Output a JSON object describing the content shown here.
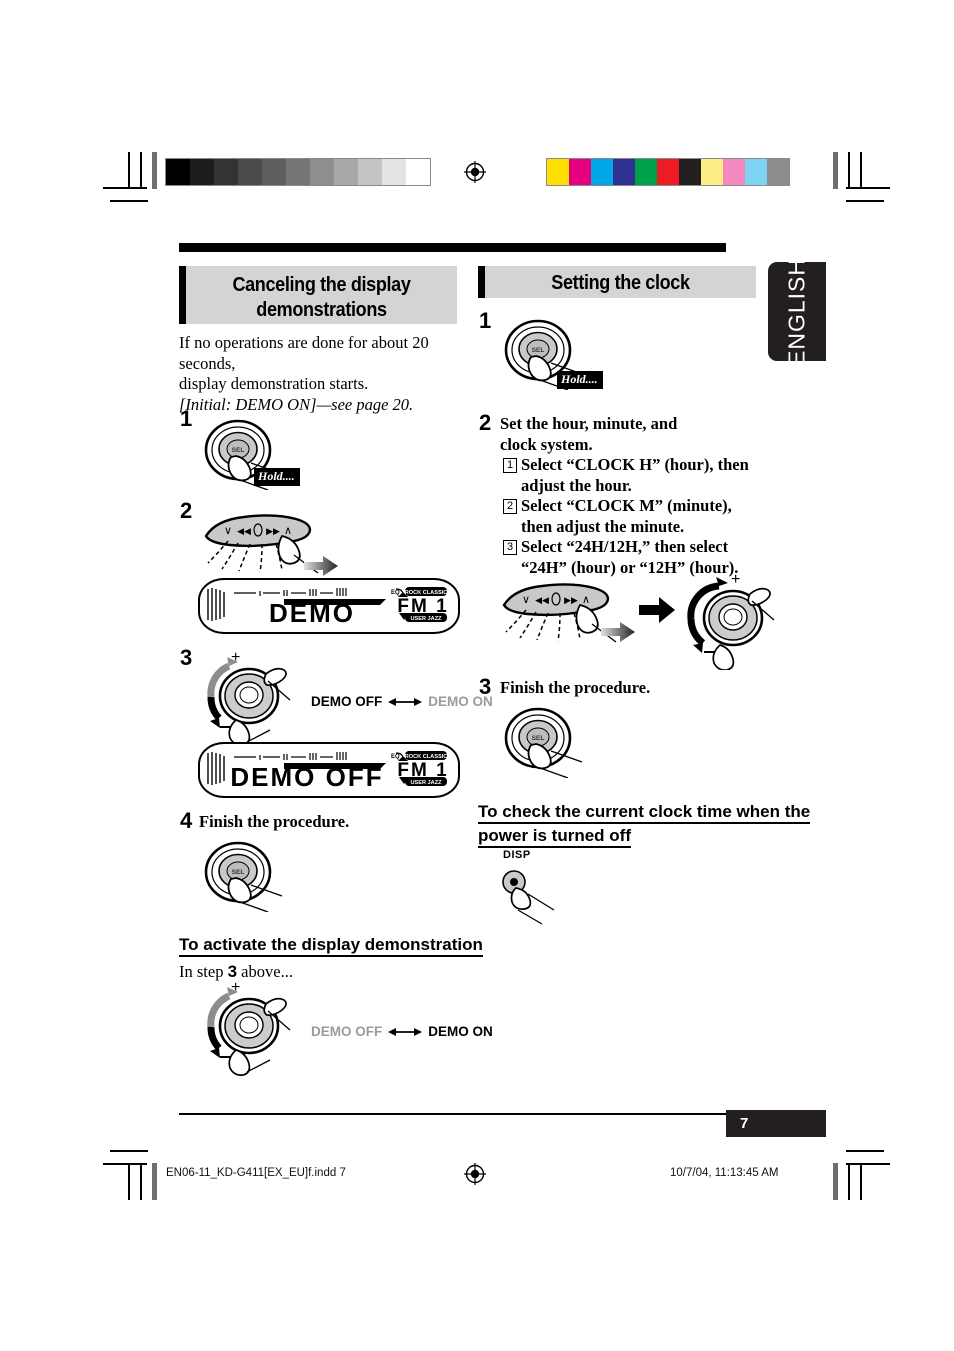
{
  "page": {
    "number": "7",
    "language_tab": "ENGLISH"
  },
  "calibration": {
    "gray_ramp": [
      "#000000",
      "#1c1c1c",
      "#333333",
      "#4a4a4a",
      "#5e5e5e",
      "#767676",
      "#8e8e8e",
      "#a8a8a8",
      "#c4c4c4",
      "#e4e4e4",
      "#ffffff"
    ],
    "color_ramp": [
      "#fddf00",
      "#e5007d",
      "#00a7e7",
      "#2e3192",
      "#00a14b",
      "#ed1c24",
      "#231f20",
      "#fced84",
      "#f489c0",
      "#7fd4f4",
      "#8d8d8d"
    ]
  },
  "left_column": {
    "heading": "Canceling the display demonstrations",
    "intro_line1": "If no operations are done for about 20 seconds,",
    "intro_line2": "display demonstration starts.",
    "intro_italic": "[Initial: DEMO ON]—see page 20.",
    "steps": [
      {
        "num": "1",
        "text": ""
      },
      {
        "num": "2",
        "text": ""
      },
      {
        "num": "3",
        "text": ""
      },
      {
        "num": "4",
        "text": "Finish the procedure."
      }
    ],
    "hold_badge": "Hold....",
    "lcd_1": {
      "main": "DEMO",
      "band": "FM 1",
      "eq_top": "ROCK CLASSIC",
      "eq_bottom": "USER JAZZ",
      "eq_label": "EQ"
    },
    "lcd_2": {
      "main": "DEMO OFF",
      "band": "FM 1",
      "eq_top": "ROCK CLASSIC",
      "eq_bottom": "USER JAZZ",
      "eq_label": "EQ"
    },
    "toggle_step3": {
      "left": "DEMO OFF",
      "right": "DEMO ON",
      "active": "left"
    },
    "subheading": "To activate the display demonstration",
    "instep_pre": "In step",
    "instep_num": "3",
    "instep_post": "above...",
    "toggle_activate": {
      "left": "DEMO OFF",
      "right": "DEMO ON",
      "active": "right"
    }
  },
  "right_column": {
    "heading": "Setting the clock",
    "hold_badge": "Hold....",
    "steps": [
      {
        "num": "1",
        "text": ""
      },
      {
        "num": "2",
        "text": "Set the hour, minute, and clock system."
      },
      {
        "num": "3",
        "text": "Finish the procedure."
      }
    ],
    "substeps": [
      {
        "marker": "1",
        "line1": "Select “CLOCK H” (hour), then",
        "line2": "adjust the hour."
      },
      {
        "marker": "2",
        "line1": "Select “CLOCK M” (minute),",
        "line2": "then adjust the minute."
      },
      {
        "marker": "3",
        "line1": "Select “24H/12H,” then select",
        "line2": "“24H” (hour) or “12H” (hour)."
      }
    ],
    "subheading_line1": "To check the current clock time when the",
    "subheading_line2": "power is turned off",
    "disp_label": "DISP"
  },
  "knob": {
    "plus": "+",
    "minus": "—",
    "sel_label": "SEL"
  },
  "rocker": {
    "symbols": [
      "∨",
      "◀◀",
      "▶▶",
      "∧"
    ]
  },
  "footer": {
    "filename": "EN06-11_KD-G411[EX_EU]f.indd   7",
    "timestamp": "10/7/04, 11:13:45 AM"
  }
}
